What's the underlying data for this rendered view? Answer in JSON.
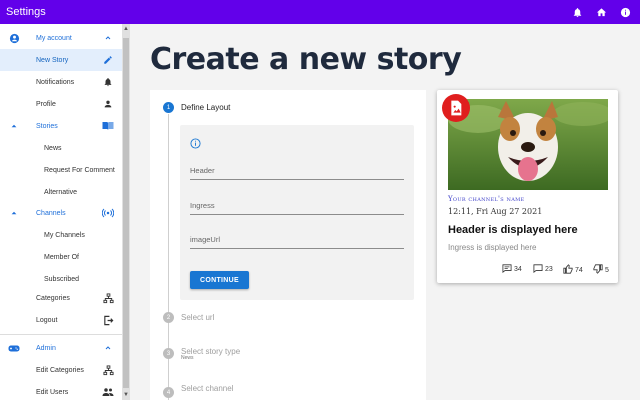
{
  "topbar": {
    "title": "Settings",
    "icons": [
      "bell-icon",
      "home-icon",
      "info-icon"
    ]
  },
  "sidebar": {
    "items": [
      {
        "label": "My account",
        "icon": "account-circle-icon",
        "section": true,
        "expanded": true
      },
      {
        "label": "New Story",
        "icon": "pencil-icon",
        "selected": true
      },
      {
        "label": "Notifications",
        "icon": "bell-icon"
      },
      {
        "label": "Profile",
        "icon": "person-icon"
      },
      {
        "label": "Stories",
        "icon": "book-icon",
        "section": true,
        "expanded": true
      },
      {
        "label": "News"
      },
      {
        "label": "Request For Comment"
      },
      {
        "label": "Alternative"
      },
      {
        "label": "Channels",
        "icon": "broadcast-icon",
        "section": true,
        "expanded": true
      },
      {
        "label": "My Channels"
      },
      {
        "label": "Member Of"
      },
      {
        "label": "Subscribed"
      },
      {
        "label": "Categories",
        "icon": "hierarchy-icon"
      },
      {
        "label": "Logout",
        "icon": "logout-icon"
      },
      {
        "label": "Admin",
        "icon": "gamepad-icon",
        "section": true,
        "expanded": true
      },
      {
        "label": "Edit Categories",
        "icon": "hierarchy-icon"
      },
      {
        "label": "Edit Users",
        "icon": "group-icon"
      }
    ]
  },
  "page": {
    "title": "Create a new story"
  },
  "stepper": {
    "steps": [
      {
        "num": "1",
        "label": "Define Layout",
        "active": true
      },
      {
        "num": "2",
        "label": "Select url"
      },
      {
        "num": "3",
        "label": "Select story type",
        "sub": "News"
      },
      {
        "num": "4",
        "label": "Select channel"
      }
    ]
  },
  "form": {
    "fields": [
      {
        "placeholder": "Header"
      },
      {
        "placeholder": "Ingress"
      },
      {
        "placeholder": "imageUrl"
      }
    ],
    "continue_label": "CONTINUE"
  },
  "preview": {
    "channel_name": "Your channel's name",
    "date": "12:11, Fri Aug 27 2021",
    "header": "Header is displayed here",
    "ingress": "Ingress is displayed here",
    "stats": {
      "comments": "34",
      "chats": "23",
      "likes": "74",
      "dislikes": "5"
    }
  },
  "colors": {
    "appbar": "#6200ea",
    "accent": "#1976d2",
    "badge": "#e01e1e"
  }
}
